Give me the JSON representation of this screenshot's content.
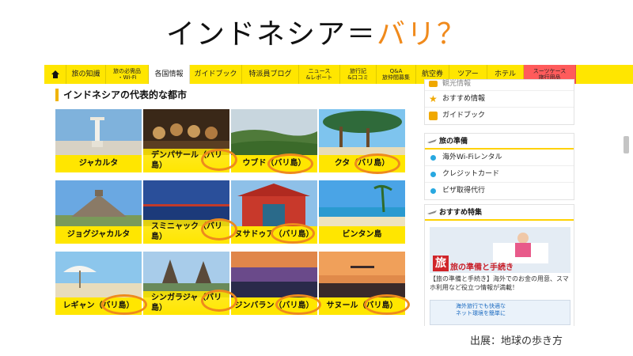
{
  "title": {
    "main": "インドネシア＝",
    "accent": "バリ？"
  },
  "nav": {
    "items": [
      {
        "label": "旅の知識"
      },
      {
        "label": "旅の必需品\n・Wi-Fi"
      },
      {
        "label": "各国情報"
      },
      {
        "label": "ガイドブック"
      },
      {
        "label": "特派員ブログ"
      },
      {
        "label": "ニュース\n&レポート"
      },
      {
        "label": "旅行記\n&口コミ"
      },
      {
        "label": "Q&A\n旅仲間募集"
      },
      {
        "label": "航空券"
      },
      {
        "label": "ツアー"
      },
      {
        "label": "ホテル"
      },
      {
        "label": "スーツケース\n旅行用品"
      }
    ]
  },
  "main": {
    "section_title": "インドネシアの代表的な都市",
    "cities": [
      {
        "name": "ジャカルタ"
      },
      {
        "name": "デンパサール（バリ\n島）"
      },
      {
        "name": "ウブド（バリ島）"
      },
      {
        "name": "クタ（バリ島）"
      },
      {
        "name": "ジョグジャカルタ"
      },
      {
        "name": "スミニャック（バリ\n島）"
      },
      {
        "name": "ヌサドゥア（バリ島）"
      },
      {
        "name": "ビンタン島"
      },
      {
        "name": "レギャン（バリ島）"
      },
      {
        "name": "シンガラジャ（バリ\n島）"
      },
      {
        "name": "ジンバラン（バリ島）"
      },
      {
        "name": "サヌール（バリ島）"
      }
    ]
  },
  "sidebar": {
    "top_items": [
      {
        "label": "観光情報"
      },
      {
        "label": "おすすめ情報"
      },
      {
        "label": "ガイドブック"
      }
    ],
    "prep": {
      "heading": "旅の準備",
      "items": [
        {
          "label": "海外Wi-Fiレンタル"
        },
        {
          "label": "クレジットカード"
        },
        {
          "label": "ビザ取得代行"
        }
      ]
    },
    "featured": {
      "heading": "おすすめ特集",
      "banner_text": "旅の準備と手続き",
      "banner_char": "旅",
      "desc": "【旅の準備と手続き】海外でのお金の用意、スマホ利用など役立つ情報が満載！",
      "banner2_text": "海外旅行でも快適な\nネット環境を簡単に"
    }
  },
  "source": "出展：地球の歩き方",
  "colors": {
    "accent": "#f08a1c",
    "nav_yellow": "#ffe600",
    "ring_orange": "#ee8a1d"
  }
}
